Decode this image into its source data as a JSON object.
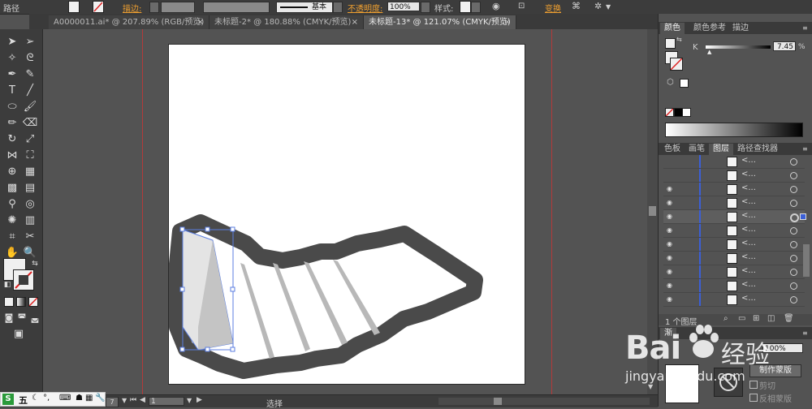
{
  "control_bar": {
    "title": "路径",
    "stroke_label": "描边:",
    "stroke_style": "基本",
    "opacity_label": "不透明度:",
    "opacity_value": "100%",
    "style_label": "样式:",
    "transform_label": "变换",
    "accent_color": "#f0a030"
  },
  "tabs": [
    {
      "label": "A0000011.ai* @ 207.89% (RGB/预览)",
      "active": false
    },
    {
      "label": "未标题-2* @ 180.88% (CMYK/预览)",
      "active": false
    },
    {
      "label": "未标题-13* @ 121.07% (CMYK/预览)",
      "active": true
    }
  ],
  "tab_close_glyph": "×",
  "color_panel": {
    "tabs": [
      "颜色",
      "颜色参考",
      "描边"
    ],
    "channel_label": "K",
    "channel_value": "7.45",
    "unit": "%"
  },
  "layers_panel": {
    "tabs": [
      "色板",
      "画笔",
      "图层",
      "路径查找器"
    ],
    "row_name": "<...",
    "footer_count": "1 个图层"
  },
  "transparency_panel": {
    "tab_partial": "渐",
    "mask_button": "制作蒙版",
    "clip_label": "剪切",
    "invert_label": "反相蒙版",
    "opacity_value": "100%"
  },
  "status_bar": {
    "zoom_value": "7",
    "page_value": "1",
    "mode": "选择"
  },
  "watermark": {
    "brand": "Bai",
    "brand_cn": "经验",
    "url": "jingyan.baidu.com"
  },
  "taskbar": {
    "ime_label": "五"
  }
}
